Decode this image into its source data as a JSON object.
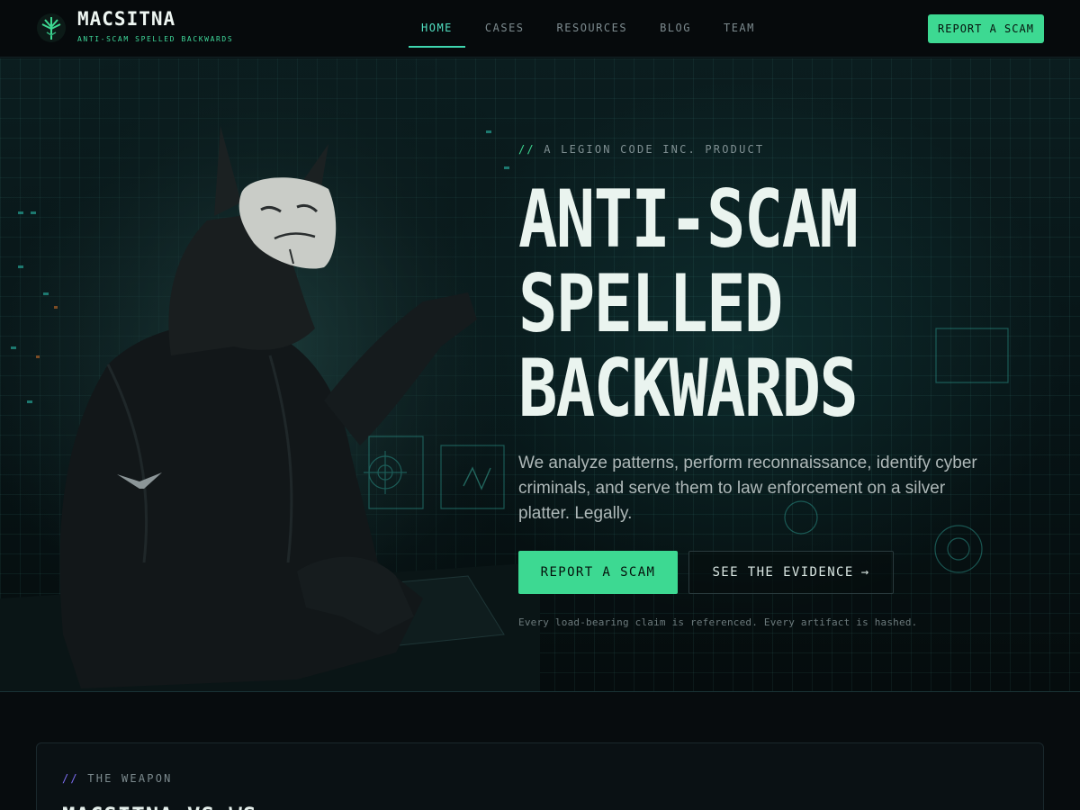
{
  "brand": {
    "name": "MACSITNA",
    "tagline": "ANTI-SCAM SPELLED BACKWARDS"
  },
  "nav": {
    "items": [
      {
        "label": "HOME",
        "active": true
      },
      {
        "label": "CASES",
        "active": false
      },
      {
        "label": "RESOURCES",
        "active": false
      },
      {
        "label": "BLOG",
        "active": false
      },
      {
        "label": "TEAM",
        "active": false
      }
    ],
    "cta_label": "REPORT A SCAM"
  },
  "hero": {
    "kicker_slashes": "//",
    "kicker_text": "A LEGION CODE INC. PRODUCT",
    "headline_lines": [
      "ANTI-SCAM",
      "SPELLED",
      "BACKWARDS"
    ],
    "lede": "We analyze patterns, perform reconnaissance, identify cyber criminals, and serve them to law enforcement on a silver platter. Legally.",
    "primary_button": "REPORT A SCAM",
    "secondary_button": "SEE THE EVIDENCE",
    "secondary_arrow": "→",
    "footnote": "Every load-bearing claim is referenced. Every artifact is hashed."
  },
  "section": {
    "kicker_slashes": "//",
    "kicker_text": "THE WEAPON",
    "title": "MACSITNA VS WS"
  },
  "colors": {
    "accent": "#3dd992",
    "active_nav": "#51e0c2",
    "section_slashes": "#7b6cf0",
    "background": "#05090b"
  },
  "icons": {
    "logo": "trident-leaf-icon",
    "hero_image": "hooded-llama-mask-illustration"
  }
}
